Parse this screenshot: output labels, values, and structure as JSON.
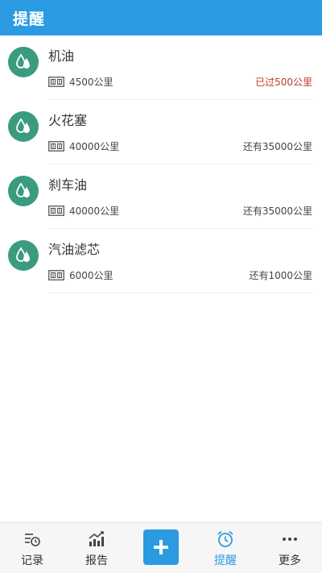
{
  "header": {
    "title": "提醒"
  },
  "items": [
    {
      "name": "机油",
      "distance": "4500公里",
      "status": "已过500公里",
      "overdue": true
    },
    {
      "name": "火花塞",
      "distance": "40000公里",
      "status": "还有35000公里",
      "overdue": false
    },
    {
      "name": "刹车油",
      "distance": "40000公里",
      "status": "还有35000公里",
      "overdue": false
    },
    {
      "name": "汽油滤芯",
      "distance": "6000公里",
      "status": "还有1000公里",
      "overdue": false
    }
  ],
  "nav": {
    "record": "记录",
    "report": "报告",
    "reminder": "提醒",
    "more": "更多"
  },
  "colors": {
    "primary": "#2a9be2",
    "avatar": "#3a9b7e",
    "overdue": "#c0392b"
  },
  "icons": {
    "item_avatar": "oil-drop-icon",
    "distance": "odometer-icon",
    "record": "record-icon",
    "report": "chart-icon",
    "add": "plus-icon",
    "reminder": "alarm-clock-icon",
    "more": "more-dots-icon"
  }
}
